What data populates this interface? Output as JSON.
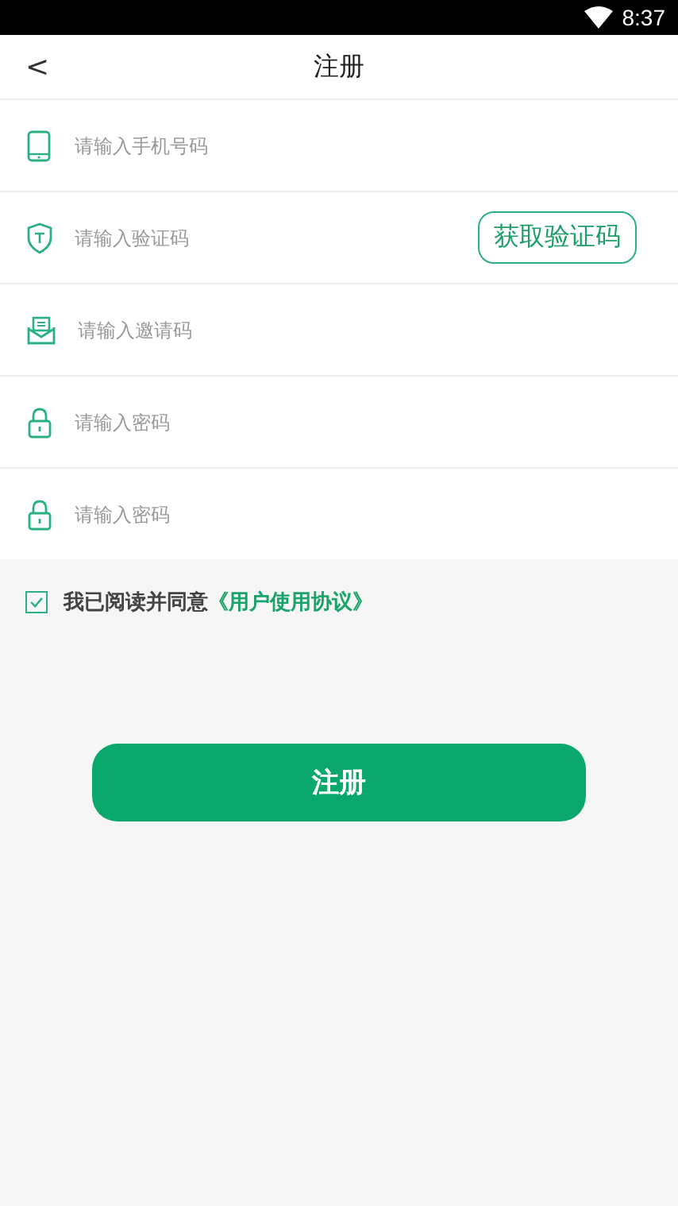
{
  "status_bar": {
    "time": "8:37"
  },
  "header": {
    "back": "<",
    "title": "注册"
  },
  "fields": [
    {
      "kind": "phone",
      "placeholder": "请输入手机号码"
    },
    {
      "kind": "code",
      "placeholder": "请输入验证码",
      "action": "获取验证码"
    },
    {
      "kind": "invite",
      "placeholder": "请输入邀请码"
    },
    {
      "kind": "password",
      "placeholder": "请输入密码"
    },
    {
      "kind": "password",
      "placeholder": "请输入密码"
    }
  ],
  "agreement": {
    "checked": true,
    "text": "我已阅读并同意",
    "link": "《用户使用协议》"
  },
  "submit": "注册"
}
